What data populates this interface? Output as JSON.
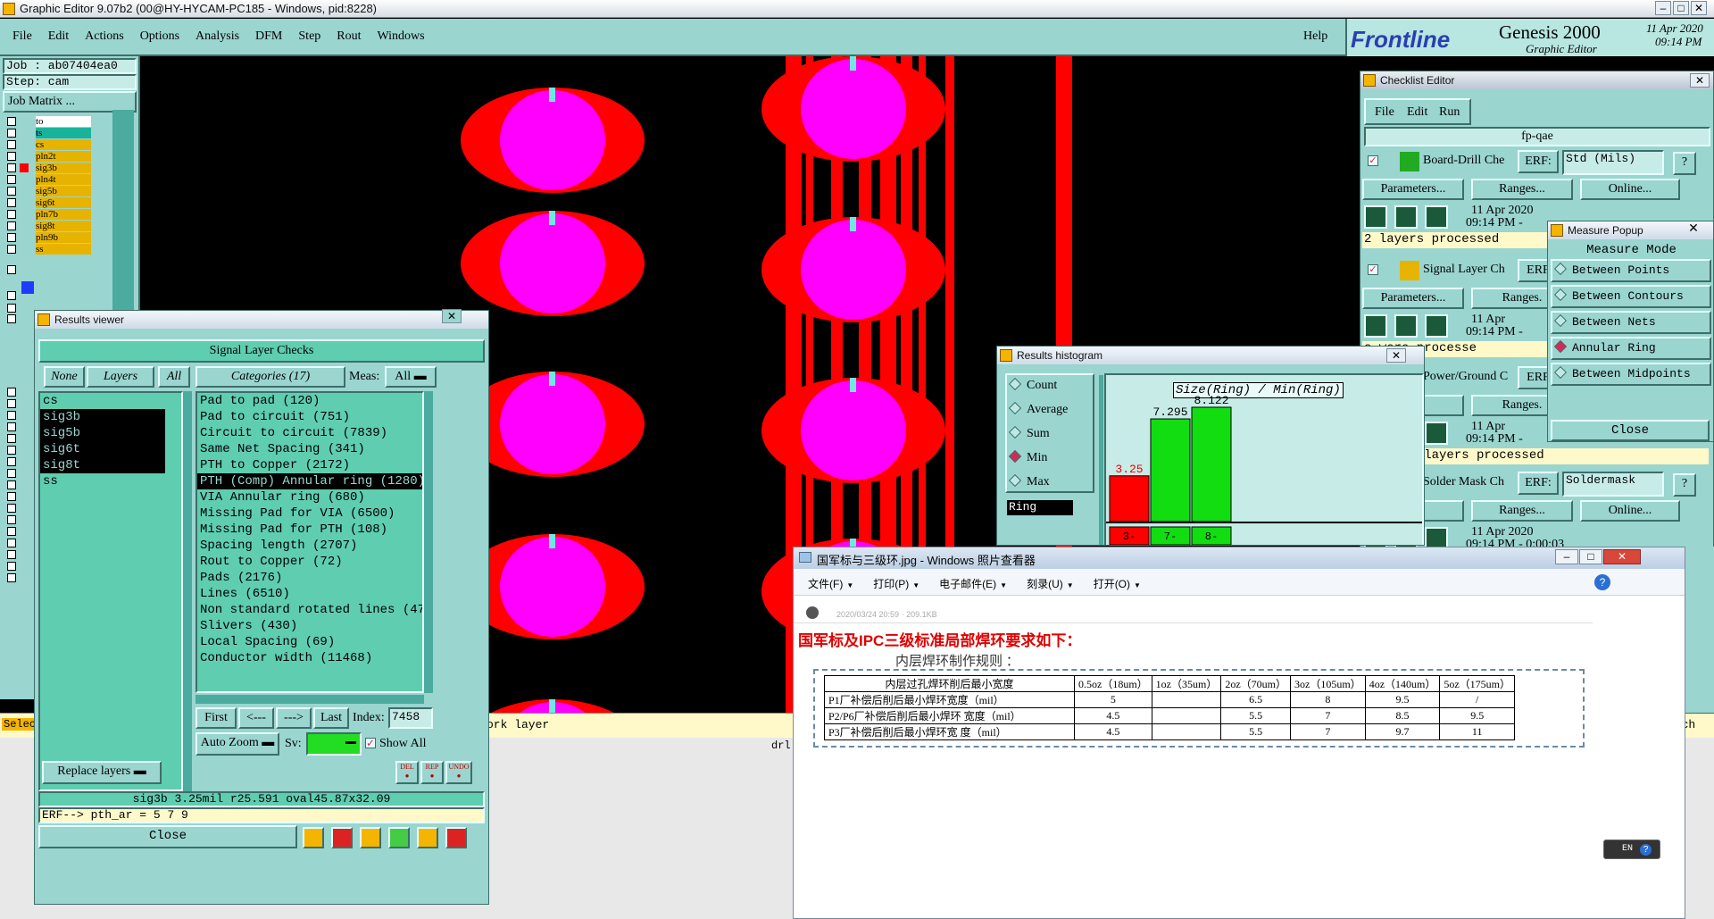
{
  "titlebar": {
    "title": "Graphic Editor 9.07b2 (00@HY-HYCAM-PC185 - Windows, pid:8228)"
  },
  "menu": {
    "items": [
      "File",
      "Edit",
      "Actions",
      "Options",
      "Analysis",
      "DFM",
      "Step",
      "Rout",
      "Windows"
    ],
    "help": "Help"
  },
  "brand": {
    "logo": "Frontline",
    "product": "Genesis 2000",
    "subtitle": "Graphic Editor",
    "date": "11 Apr 2020",
    "time": "09:14 PM"
  },
  "job": {
    "job_label": "Job : ab07404ea0",
    "step_label": "Step: cam",
    "job_matrix": "Job Matrix ..."
  },
  "layers": [
    "to",
    "ts",
    "cs",
    "pln2t",
    "sig3b",
    "pln4t",
    "sig5b",
    "sig6t",
    "pln7b",
    "sig8t",
    "pln9b",
    "ss"
  ],
  "results_viewer": {
    "title": "Results viewer",
    "header": "Signal Layer Checks",
    "filter_none": "None",
    "filter_layers": "Layers",
    "filter_all": "All",
    "categories_label": "Categories (17)",
    "meas_label": "Meas:",
    "meas_value": "All",
    "layer_list": [
      "cs",
      "sig3b",
      "sig5b",
      "sig6t",
      "sig8t",
      "ss"
    ],
    "categories": [
      "Pad to pad (120)",
      "Pad to circuit (751)",
      "Circuit to circuit (7839)",
      "Same Net Spacing (341)",
      "PTH to Copper (2172)",
      "PTH (Comp) Annular ring (1280)",
      "VIA Annular ring (680)",
      "Missing Pad for VIA (6500)",
      "Missing Pad for PTH (108)",
      "Spacing length (2707)",
      "Rout to Copper (72)",
      "Pads (2176)",
      "Lines (6510)",
      "Non standard rotated lines (471)",
      "Slivers (430)",
      "Local Spacing (69)",
      "Conductor width (11468)"
    ],
    "selected_category": "PTH (Comp) Annular ring (1280)",
    "nav": {
      "first": "First",
      "prev": "<---",
      "next": "--->",
      "last": "Last",
      "index_label": "Index:",
      "index_value": "7458"
    },
    "auto_zoom": "Auto Zoom",
    "sv_label": "Sv:",
    "show_all": "Show All",
    "replace_layers": "Replace layers",
    "btn_del": "DEL",
    "btn_rep": "REP",
    "btn_undo": "UNDO",
    "status": "sig3b 3.25mil  r25.591  oval45.87x32.09",
    "erf": "ERF--> pth_ar = 5 7 9",
    "close": "Close"
  },
  "checklist": {
    "title": "Checklist Editor",
    "menu": [
      "File",
      "Edit",
      "Run"
    ],
    "name": "fp-qae",
    "checks": [
      {
        "name": "Board-Drill Che",
        "erf": "ERF:",
        "erf_value": "Std (Mils)",
        "params": "Parameters...",
        "ranges": "Ranges...",
        "online": "Online...",
        "date": "11 Apr 2020",
        "time": "09:14 PM -",
        "status": "2 layers processed"
      },
      {
        "name": "Signal Layer Ch",
        "erf": "ERF",
        "params": "Parameters...",
        "ranges": "Ranges.",
        "date": "11 Apr",
        "time": "09:14 PM -",
        "status": "s were processe"
      },
      {
        "name": "Power/Ground C",
        "erf": "ERF",
        "params": "ers...",
        "ranges": "Ranges.",
        "date": "11 Apr",
        "time": "09:14 PM -",
        "status": "/ground layers processed"
      },
      {
        "name": "Solder Mask Ch",
        "erf": "ERF:",
        "erf_value": "Soldermask",
        "params": "ers...",
        "ranges": "Ranges...",
        "online": "Online...",
        "date": "11 Apr 2020",
        "time": "09:14 PM - 0:00:03"
      }
    ]
  },
  "measure": {
    "title": "Measure Popup",
    "mode_label": "Measure Mode",
    "modes": [
      "Between Points",
      "Between Contours",
      "Between Nets",
      "Annular Ring",
      "Between Midpoints"
    ],
    "selected": "Annular Ring",
    "close": "Close"
  },
  "histogram": {
    "title": "Results histogram",
    "options": [
      "Count",
      "Average",
      "Sum",
      "Min",
      "Max"
    ],
    "selected": "Min",
    "field": "Ring",
    "chart_title": "Size(Ring) / Min(Ring)",
    "bins": [
      "3-",
      "7-",
      "8-"
    ],
    "chart_data": {
      "type": "bar",
      "title": "Size(Ring) / Min(Ring)",
      "categories": [
        "3-",
        "7-",
        "8-"
      ],
      "values": [
        3.25,
        7.295,
        8.122
      ],
      "colors": [
        "#ff0000",
        "#11dd11",
        "#11dd11"
      ]
    }
  },
  "photo": {
    "title": "国军标与三级环.jpg - Windows 照片查看器",
    "menu": [
      "文件(F)",
      "打印(P)",
      "电子邮件(E)",
      "刻录(U)",
      "打开(O)"
    ],
    "meta": "2020/03/24 20:59 · 209.1KB",
    "heading": "国军标及IPC三级标准局部焊环要求如下：",
    "subheading": "内层焊环制作规则 ：",
    "table": {
      "headers": [
        "内层过孔焊环削后最小宽度",
        "0.5oz（18um）",
        "1oz（35um）",
        "2oz（70um）",
        "3oz（105um）",
        "4oz（140um）",
        "5oz（175um）"
      ],
      "rows": [
        [
          "P1厂补偿后削后最小焊环宽度（mil）",
          "5",
          "",
          "6.5",
          "8",
          "9.5",
          "/"
        ],
        [
          "P2/P6厂补偿后削后最小焊环 宽度（mil）",
          "4.5",
          "",
          "5.5",
          "7",
          "8.5",
          "9.5"
        ],
        [
          "P3厂补偿后削后最小焊环宽 度（mil）",
          "4.5",
          "",
          "5.5",
          "7",
          "9.7",
          "11"
        ]
      ]
    }
  },
  "bottom": {
    "select": "Selec",
    "work_layer": "ork layer",
    "units": "Inch",
    "drl": "drl"
  },
  "ime": "EN"
}
